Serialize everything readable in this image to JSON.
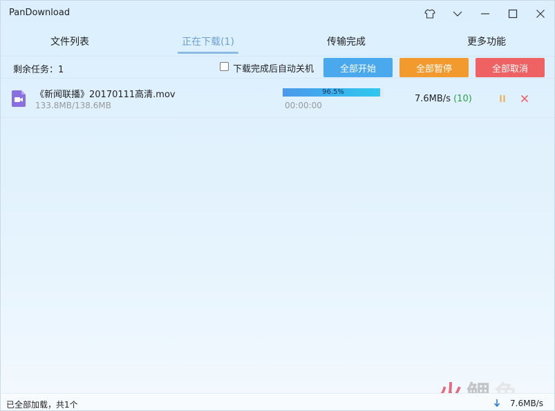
{
  "window": {
    "title": "PanDownload",
    "controls": [
      "skin-icon",
      "menu-chevron-icon",
      "minimize-icon",
      "maximize-icon",
      "close-icon"
    ]
  },
  "tabs": [
    {
      "label": "文件列表",
      "active": false
    },
    {
      "label": "正在下载(1)",
      "active": true
    },
    {
      "label": "传输完成",
      "active": false
    },
    {
      "label": "更多功能",
      "active": false
    }
  ],
  "toolbar": {
    "remaining_tasks": "剩余任务：1",
    "auto_shutdown_label": "下载完成后自动关机",
    "auto_shutdown_checked": false,
    "start_all": "全部开始",
    "pause_all": "全部暂停",
    "cancel_all": "全部取消"
  },
  "downloads": [
    {
      "icon": "video-file-icon",
      "name": "《新闻联播》20170111高清.mov",
      "size": "133.8MB/138.6MB",
      "progress_percent": 96.5,
      "progress_label": "96.5%",
      "elapsed": "00:00:00",
      "speed": "7.6MB/s",
      "connections": "(10)"
    }
  ],
  "statusbar": {
    "text": "已全部加载，共1个",
    "speed": "7.6MB/s"
  },
  "watermark": {
    "text": [
      "火",
      "鲤",
      "鱼"
    ]
  },
  "colors": {
    "accent_tab": "#6f9fd1",
    "start": "#4aa9ec",
    "pause": "#f39a2e",
    "cancel": "#ef6263",
    "connections": "#2ea04a"
  }
}
